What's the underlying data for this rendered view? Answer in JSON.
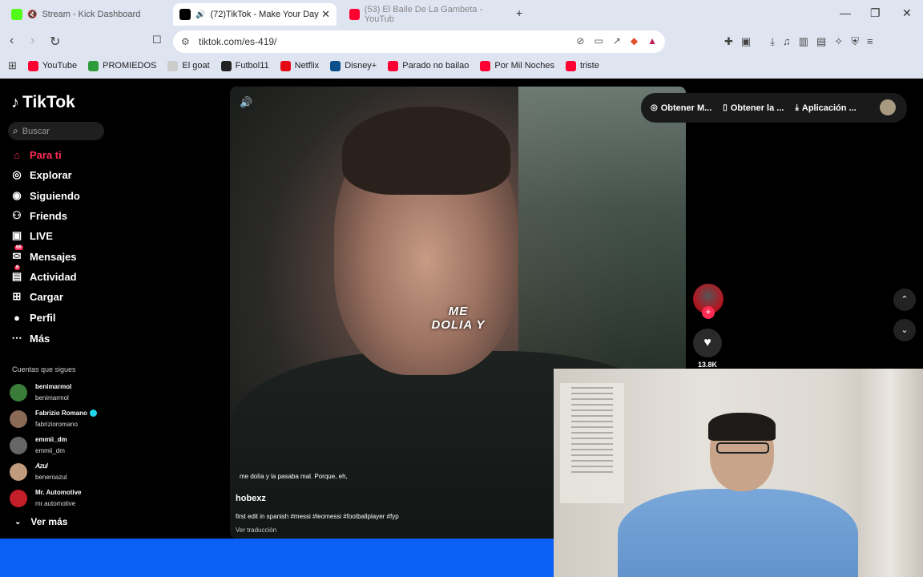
{
  "browser": {
    "tabs": [
      {
        "label": "Stream - Kick Dashboard",
        "color": "#53fc18"
      },
      {
        "label": "(72)TikTok - Make Your Day",
        "color": "#000000"
      },
      {
        "label": "(53) El Baile De La Gambeta - YouTub",
        "color": "#ff0033"
      }
    ],
    "new_tab": "+",
    "url": "tiktok.com/es-419/",
    "bookmarks": [
      {
        "label": "YouTube",
        "color": "#ff0033"
      },
      {
        "label": "PROMIEDOS",
        "color": "#2e9b3a"
      },
      {
        "label": "El goat",
        "color": "#cccccc"
      },
      {
        "label": "Futbol11",
        "color": "#222222"
      },
      {
        "label": "Netflix",
        "color": "#e50914"
      },
      {
        "label": "Disney+",
        "color": "#0b4f8a"
      },
      {
        "label": "Parado no bailao",
        "color": "#ff0033"
      },
      {
        "label": "Por Mil Noches",
        "color": "#ff0033"
      },
      {
        "label": "triste",
        "color": "#ff0033"
      }
    ]
  },
  "sidebar": {
    "logo": "TikTok",
    "search_placeholder": "Buscar",
    "nav": [
      {
        "label": "Para ti",
        "icon": "home-icon",
        "active": true
      },
      {
        "label": "Explorar",
        "icon": "compass-icon"
      },
      {
        "label": "Siguiendo",
        "icon": "following-icon"
      },
      {
        "label": "Friends",
        "icon": "friends-icon"
      },
      {
        "label": "LIVE",
        "icon": "live-icon"
      },
      {
        "label": "Mensajes",
        "icon": "messages-icon",
        "badge": "66"
      },
      {
        "label": "Actividad",
        "icon": "activity-icon",
        "badge": "6"
      },
      {
        "label": "Cargar",
        "icon": "upload-icon"
      },
      {
        "label": "Perfil",
        "icon": "profile-icon"
      },
      {
        "label": "Más",
        "icon": "more-icon"
      }
    ],
    "following_title": "Cuentas que sigues",
    "following": [
      {
        "name": "benimarmol",
        "handle": "benimarmol",
        "color": "#3a7d3a"
      },
      {
        "name": "Fabrizio Romano",
        "handle": "fabrizioromano",
        "verified": true,
        "color": "#8a6a55"
      },
      {
        "name": "emmii_dm",
        "handle": "emmii_dm",
        "color": "#666666"
      },
      {
        "name": "𝐴𝑧𝑢𝑙",
        "handle": "beneroazul",
        "color": "#c29a7c"
      },
      {
        "name": "Mr. Automotive",
        "handle": "mr.automotive",
        "color": "#c41e2a"
      }
    ],
    "see_more": "Ver más"
  },
  "video": {
    "caption_line1": "ME",
    "caption_line2": "DOLIA Y",
    "subtitle": "me dolía y la pasaba mal. Porque, eh,",
    "author": "hobexz",
    "description": "first edit in spanish #messi #leomessi #footballplayer #fyp",
    "translate": "Ver traducción",
    "likes": "13.8K"
  },
  "topbar": {
    "items": [
      "Obtener M...",
      "Obtener la ...",
      "Aplicación ..."
    ]
  },
  "webcam": {
    "description_only": true
  }
}
